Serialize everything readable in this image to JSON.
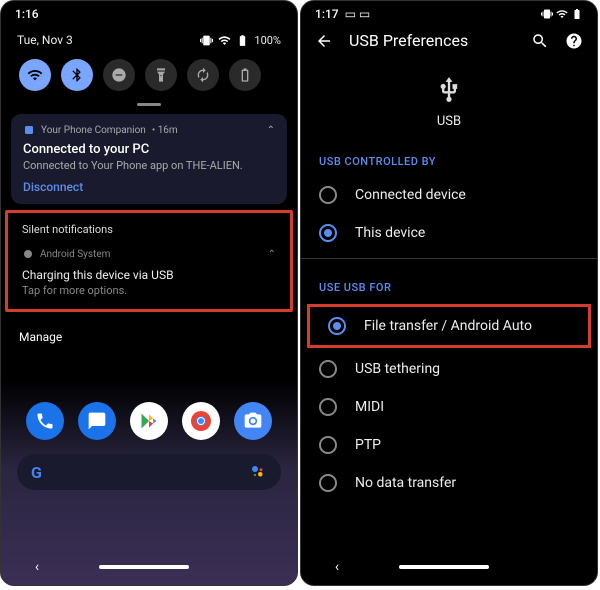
{
  "left": {
    "status_time": "1:16",
    "date": "Tue, Nov 3",
    "battery_pct": "100%",
    "toggles": [
      "wifi",
      "bluetooth",
      "dnd",
      "flashlight",
      "rotate",
      "battery-saver"
    ],
    "notif": {
      "app_name": "Your Phone Companion",
      "age": "16m",
      "title": "Connected to your PC",
      "body": "Connected to Your Phone app on THE-ALIEN.",
      "action": "Disconnect"
    },
    "silent_header": "Silent notifications",
    "sys_notif": {
      "app_name": "Android System",
      "title": "Charging this device via USB",
      "body": "Tap for more options."
    },
    "manage": "Manage",
    "apps": [
      "phone",
      "messages",
      "play-store",
      "chrome",
      "camera"
    ],
    "search_brand": "G"
  },
  "right": {
    "status_time": "1:17",
    "title": "USB Preferences",
    "usb_label": "USB",
    "section_controlled": "USB CONTROLLED BY",
    "controlled_options": [
      {
        "label": "Connected device",
        "selected": false
      },
      {
        "label": "This device",
        "selected": true
      }
    ],
    "section_use": "USE USB FOR",
    "use_options": [
      {
        "label": "File transfer / Android Auto",
        "selected": true,
        "highlight": true
      },
      {
        "label": "USB tethering",
        "selected": false
      },
      {
        "label": "MIDI",
        "selected": false
      },
      {
        "label": "PTP",
        "selected": false
      },
      {
        "label": "No data transfer",
        "selected": false
      }
    ]
  }
}
